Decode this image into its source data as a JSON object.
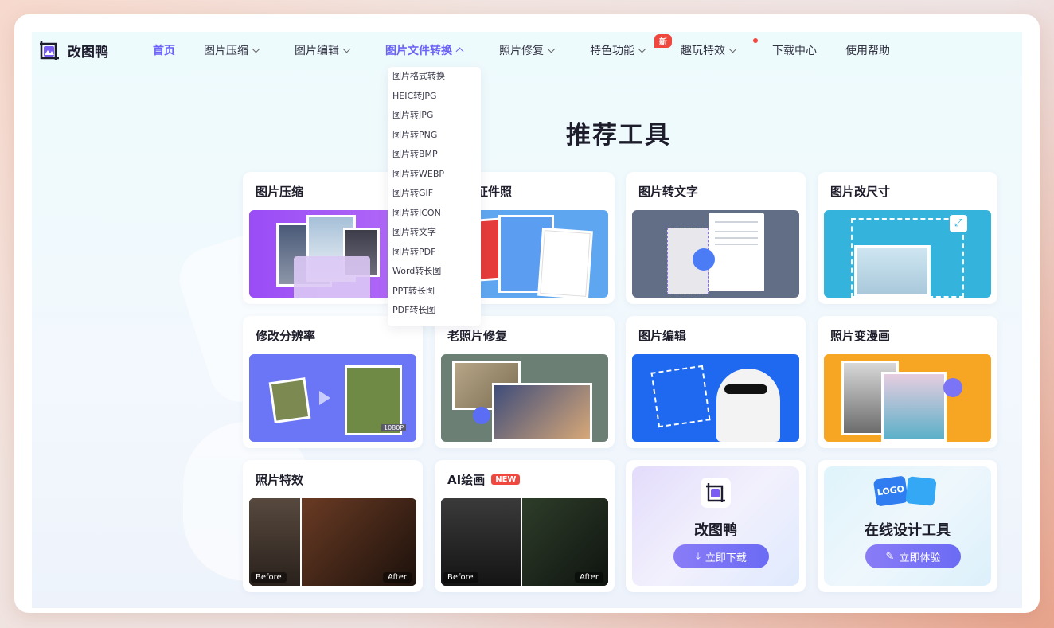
{
  "app": {
    "name": "改图鸭"
  },
  "nav": [
    {
      "label": "首页",
      "active": true,
      "chevron": ""
    },
    {
      "label": "图片压缩",
      "chevron": "down"
    },
    {
      "label": "图片编辑",
      "chevron": "down"
    },
    {
      "label": "图片文件转换",
      "chevron": "up",
      "open": true
    },
    {
      "label": "照片修复",
      "chevron": "down"
    },
    {
      "label": "特色功能",
      "chevron": "down",
      "badge": "新"
    },
    {
      "label": "趣玩特效",
      "chevron": "down",
      "dot": true
    },
    {
      "label": "下载中心",
      "chevron": ""
    },
    {
      "label": "使用帮助",
      "chevron": ""
    }
  ],
  "dropdown": [
    "图片格式转换",
    "HEIC转JPG",
    "图片转JPG",
    "图片转PNG",
    "图片转BMP",
    "图片转WEBP",
    "图片转GIF",
    "图片转ICON",
    "图片转文字",
    "图片转PDF",
    "Word转长图",
    "PPT转长图",
    "PDF转长图"
  ],
  "section_title": "推荐工具",
  "cards": [
    {
      "title": "图片压缩"
    },
    {
      "title": "证件照",
      "title_visible": "证件照"
    },
    {
      "title": "图片转文字"
    },
    {
      "title": "图片改尺寸"
    },
    {
      "title": "修改分辨率",
      "img_label": "1080P"
    },
    {
      "title": "老照片修复"
    },
    {
      "title": "图片编辑"
    },
    {
      "title": "照片变漫画"
    },
    {
      "title": "照片特效",
      "before": "Before",
      "after": "After"
    },
    {
      "title": "AI绘画",
      "tag": "NEW",
      "before": "Before",
      "after": "After"
    }
  ],
  "promos": [
    {
      "title": "改图鸭",
      "button": "立即下载"
    },
    {
      "title": "在线设计工具",
      "button": "立即体验"
    }
  ],
  "colors": {
    "accent": "#6b63f6",
    "badge": "#f0473e",
    "text": "#1d1d2b"
  }
}
